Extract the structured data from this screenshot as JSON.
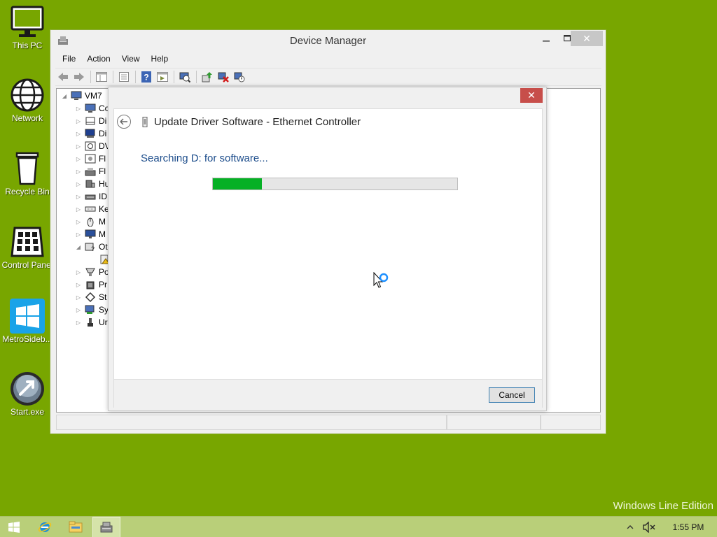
{
  "desktop": {
    "icons": [
      {
        "label": "This PC",
        "icon": "this-pc-icon"
      },
      {
        "label": "Network",
        "icon": "network-icon"
      },
      {
        "label": "Recycle Bin",
        "icon": "recycle-bin-icon"
      },
      {
        "label": "Control Panel",
        "icon": "control-panel-icon"
      },
      {
        "label": "MetroSideb...",
        "icon": "metro-sidebar-icon"
      },
      {
        "label": "Start.exe",
        "icon": "start-exe-icon"
      }
    ],
    "watermark": "Windows Line Edition",
    "background_color": "#78a600"
  },
  "device_manager": {
    "title": "Device Manager",
    "menu": [
      "File",
      "Action",
      "View",
      "Help"
    ],
    "toolbar_icons": [
      "back-icon",
      "forward-icon",
      "console-tree-icon",
      "properties-icon",
      "help-icon",
      "view-icon",
      "scan-hardware-icon",
      "update-driver-icon",
      "uninstall-icon",
      "disable-icon"
    ],
    "tree": {
      "root": "VM7",
      "items": [
        {
          "label": "Co",
          "icon": "computer-icon",
          "expanded": false
        },
        {
          "label": "Di",
          "icon": "disk-drive-icon",
          "expanded": false
        },
        {
          "label": "Di",
          "icon": "display-adapter-icon",
          "expanded": false
        },
        {
          "label": "DV",
          "icon": "dvd-drive-icon",
          "expanded": false
        },
        {
          "label": "Fl",
          "icon": "floppy-drive-icon",
          "expanded": false
        },
        {
          "label": "Fl",
          "icon": "floppy-controller-icon",
          "expanded": false
        },
        {
          "label": "Hu",
          "icon": "hid-icon",
          "expanded": false
        },
        {
          "label": "ID",
          "icon": "ide-controller-icon",
          "expanded": false
        },
        {
          "label": "Ke",
          "icon": "keyboard-icon",
          "expanded": false
        },
        {
          "label": "M",
          "icon": "mouse-icon",
          "expanded": false
        },
        {
          "label": "M",
          "icon": "monitor-icon",
          "expanded": false
        },
        {
          "label": "Ot",
          "icon": "other-devices-icon",
          "expanded": true
        },
        {
          "label": "",
          "icon": "unknown-device-warning-icon",
          "child": true
        },
        {
          "label": "Po",
          "icon": "ports-icon",
          "expanded": false
        },
        {
          "label": "Pr",
          "icon": "processor-icon",
          "expanded": false
        },
        {
          "label": "St",
          "icon": "storage-controller-icon",
          "expanded": false
        },
        {
          "label": "Sy",
          "icon": "system-devices-icon",
          "expanded": false
        },
        {
          "label": "Ur",
          "icon": "usb-controller-icon",
          "expanded": false
        }
      ]
    }
  },
  "dialog": {
    "title": "Update Driver Software - Ethernet Controller",
    "status": "Searching D: for software...",
    "progress": 0.2,
    "cancel_label": "Cancel",
    "close_symbol": "✕"
  },
  "taskbar": {
    "items": [
      "start-button",
      "internet-explorer-icon",
      "file-explorer-icon",
      "device-manager-icon"
    ],
    "clock": "1:55 PM",
    "tray_icons": [
      "show-hidden-icons-icon",
      "volume-muted-icon"
    ]
  },
  "colors": {
    "accent_close": "#c74e4a",
    "progress_fill": "#06b025",
    "status_text": "#1e4e8c"
  }
}
